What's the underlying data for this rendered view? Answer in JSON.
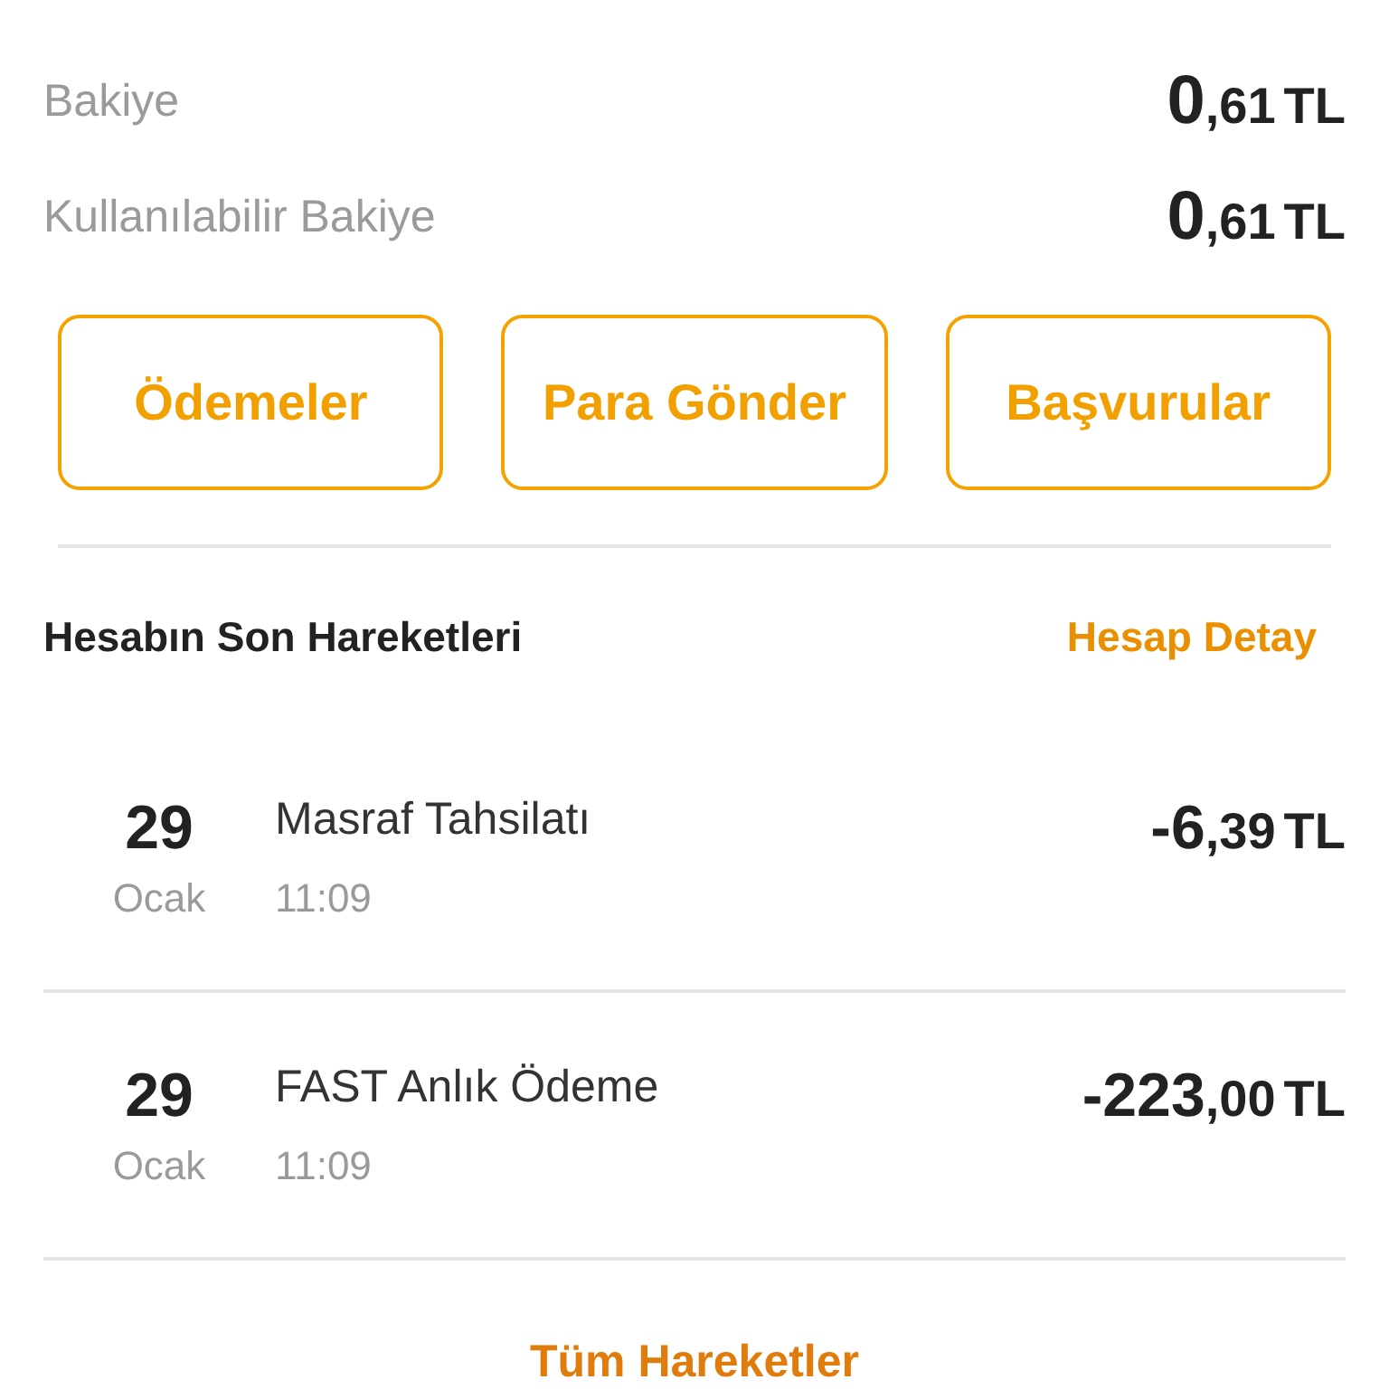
{
  "balances": [
    {
      "label": "Bakiye",
      "whole": "0",
      "fraction": ",61",
      "currency": "TL"
    },
    {
      "label": "Kullanılabilir Bakiye",
      "whole": "0",
      "fraction": ",61",
      "currency": "TL"
    }
  ],
  "actions": [
    "Ödemeler",
    "Para Gönder",
    "Başvurular"
  ],
  "section": {
    "title": "Hesabın Son Hareketleri",
    "link": "Hesap Detay"
  },
  "transactions": [
    {
      "day": "29",
      "month": "Ocak",
      "title": "Masraf Tahsilatı",
      "time": "11:09",
      "whole": "-6",
      "fraction": ",39",
      "currency": "TL"
    },
    {
      "day": "29",
      "month": "Ocak",
      "title": "FAST Anlık Ödeme",
      "time": "11:09",
      "whole": "-223",
      "fraction": ",00",
      "currency": "TL"
    }
  ],
  "footer_link": "Tüm Hareketler"
}
